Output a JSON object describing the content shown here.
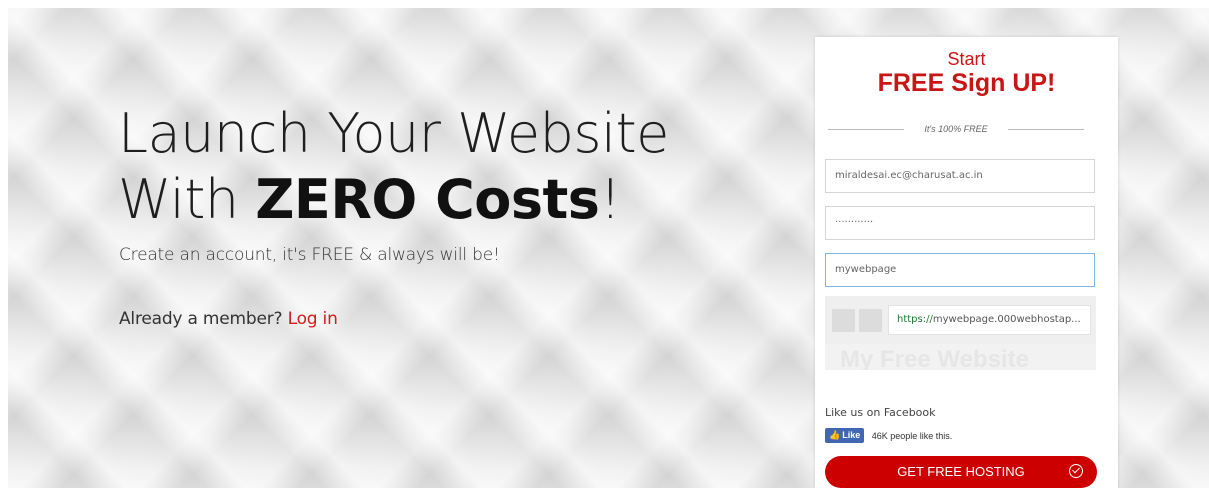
{
  "hero": {
    "headline_line1": "Launch Your Website",
    "headline_line2_prefix": "With ",
    "headline_line2_bold": "ZERO Costs",
    "headline_line2_suffix": "!",
    "subtitle": "Create an account, it's FREE & always will be!",
    "member_prompt": "Already a member?",
    "login_link": "Log in"
  },
  "signup": {
    "start_label": "Start",
    "title": "FREE Sign UP!",
    "divider_text": "It's 100% FREE",
    "email_value": "miraldesai.ec@charusat.ac.in",
    "password_value": "············",
    "website_name_value": "mywebpage",
    "preview_url_scheme": "https://",
    "preview_url_rest": "mywebpage.000webhostap...",
    "preview_site_name": "My Free Website",
    "facebook_label": "Like us on Facebook",
    "facebook_like_button": "Like",
    "facebook_count": "46K people like this.",
    "cta_label": "GET FREE HOSTING"
  },
  "colors": {
    "accent_red": "#cc0000",
    "link_red": "#d61b1b",
    "facebook_blue": "#4267b2"
  },
  "icons": {
    "facebook_like": "thumbs-up-icon",
    "cta": "check-circle-icon"
  }
}
